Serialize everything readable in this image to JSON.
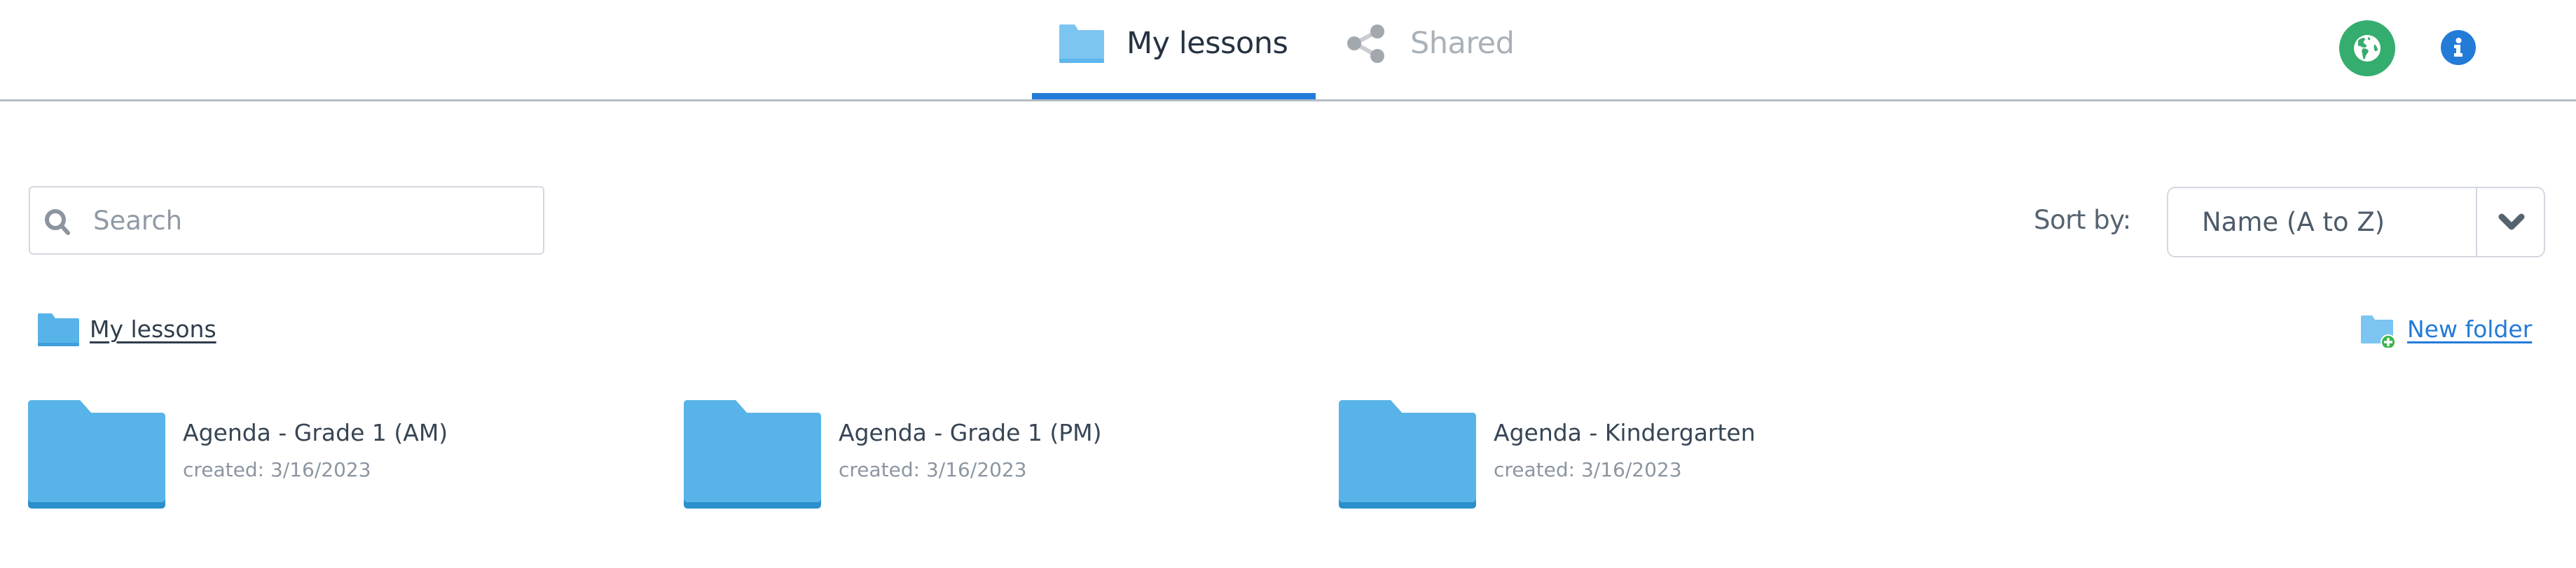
{
  "header": {
    "tabs": [
      {
        "label": "My lessons",
        "icon": "folder-icon",
        "active": true
      },
      {
        "label": "Shared",
        "icon": "share-icon",
        "active": false
      }
    ],
    "actions": [
      {
        "name": "language",
        "icon": "globe-icon"
      },
      {
        "name": "info",
        "icon": "info-icon"
      }
    ]
  },
  "toolbar": {
    "search": {
      "placeholder": "Search",
      "value": ""
    },
    "sort": {
      "label": "Sort by:",
      "value": "Name (A to Z)"
    }
  },
  "breadcrumb": {
    "label": "My lessons"
  },
  "new_folder": {
    "label": "New folder"
  },
  "folders": [
    {
      "name": "Agenda - Grade 1 (AM)",
      "created": "created: 3/16/2023"
    },
    {
      "name": "Agenda - Grade 1 (PM)",
      "created": "created: 3/16/2023"
    },
    {
      "name": "Agenda - Kindergarten",
      "created": "created: 3/16/2023"
    }
  ],
  "colors": {
    "accent": "#237bd8",
    "folder": "#58b4e8",
    "folder_shadow": "#2a8fcc",
    "globe_bg": "#35ad6f",
    "new_folder_plus": "#3cb54a"
  }
}
